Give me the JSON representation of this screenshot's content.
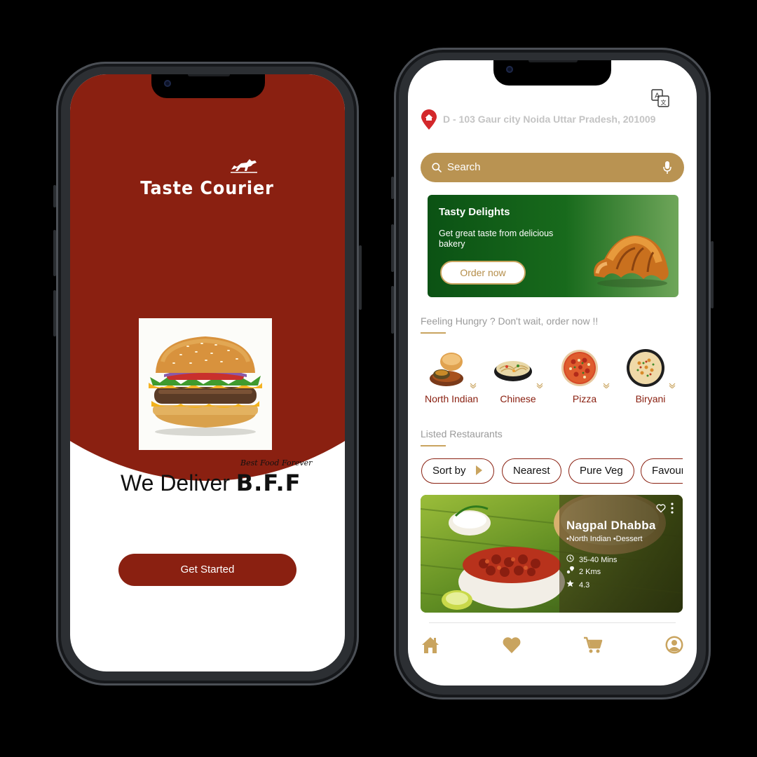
{
  "splash": {
    "brand": "Taste Courier",
    "tagline_small": "Best Food Forever",
    "tagline_main": "We Deliver ",
    "tagline_bold": "B.F.F",
    "cta": "Get Started"
  },
  "home": {
    "address": "D - 103 Gaur city  Noida Uttar Pradesh, 201009",
    "search_placeholder": "Search",
    "promo": {
      "title": "Tasty Delights",
      "desc": "Get great taste from delicious bakery",
      "button": "Order now"
    },
    "hungry_title": "Feeling Hungry ? Don't wait, order now !!",
    "categories": [
      {
        "label": "North Indian"
      },
      {
        "label": "Chinese"
      },
      {
        "label": "Pizza"
      },
      {
        "label": "Biryani"
      }
    ],
    "listed_title": "Listed Restaurants",
    "filters": [
      "Sort by",
      "Nearest",
      "Pure Veg",
      "Favour"
    ],
    "restaurant": {
      "name": "Nagpal Dhabba",
      "cuisines": "•North Indian  •Dessert",
      "time": "35-40 Mins",
      "distance": "2 Kms",
      "rating": "4.3"
    },
    "nav": [
      "home-icon",
      "heart-icon",
      "cart-icon",
      "profile-icon"
    ]
  },
  "colors": {
    "brand_red": "#8a2011",
    "gold": "#b99352",
    "promo_green": "#0b5214"
  }
}
